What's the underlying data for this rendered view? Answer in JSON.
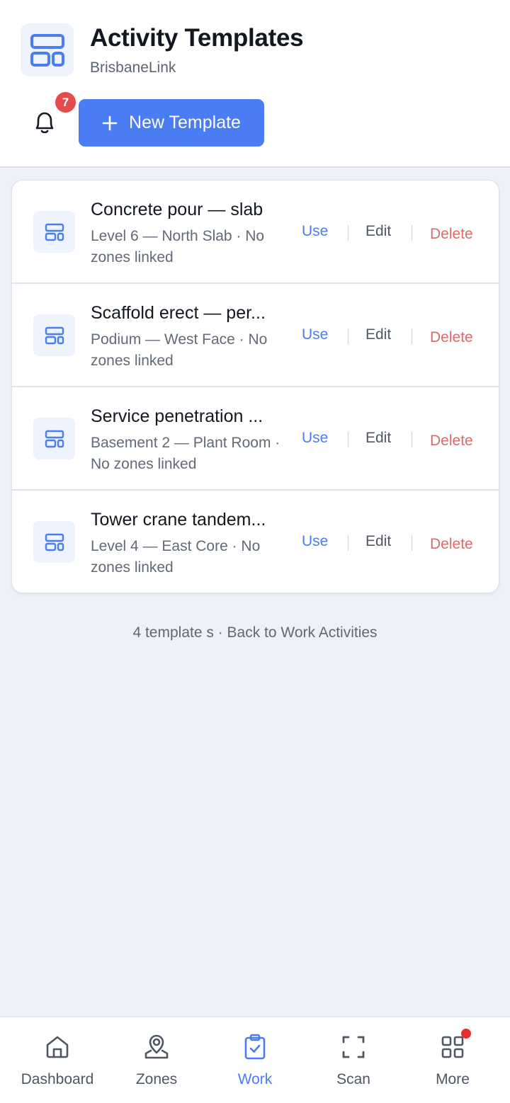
{
  "header": {
    "title": "Activity Templates",
    "subtitle": "BrisbaneLink",
    "notification_count": "7",
    "new_template_label": "New Template"
  },
  "templates": [
    {
      "title": "Concrete pour — slab",
      "subtitle": "Level 6 — North Slab · No zones linked",
      "use": "Use",
      "edit": "Edit",
      "delete": "Delete"
    },
    {
      "title": "Scaffold erect — per...",
      "subtitle": "Podium — West Face · No zones linked",
      "use": "Use",
      "edit": "Edit",
      "delete": "Delete"
    },
    {
      "title": "Service penetration ...",
      "subtitle": "Basement 2 — Plant Room · No zones linked",
      "use": "Use",
      "edit": "Edit",
      "delete": "Delete"
    },
    {
      "title": "Tower crane tandem...",
      "subtitle": "Level 4 — East Core · No zones linked",
      "use": "Use",
      "edit": "Edit",
      "delete": "Delete"
    }
  ],
  "footer": {
    "count_text": "4 template s",
    "separator": " · ",
    "back_link": "Back to Work Activities"
  },
  "nav": [
    {
      "label": "Dashboard",
      "icon": "home-icon"
    },
    {
      "label": "Zones",
      "icon": "map-pin-icon"
    },
    {
      "label": "Work",
      "icon": "clipboard-check-icon"
    },
    {
      "label": "Scan",
      "icon": "scan-frame-icon"
    },
    {
      "label": "More",
      "icon": "grid-icon"
    }
  ],
  "colors": {
    "accent": "#4a7cf3",
    "danger": "#dc6a6a",
    "badge": "#e54b4b",
    "background": "#eef2f8"
  }
}
